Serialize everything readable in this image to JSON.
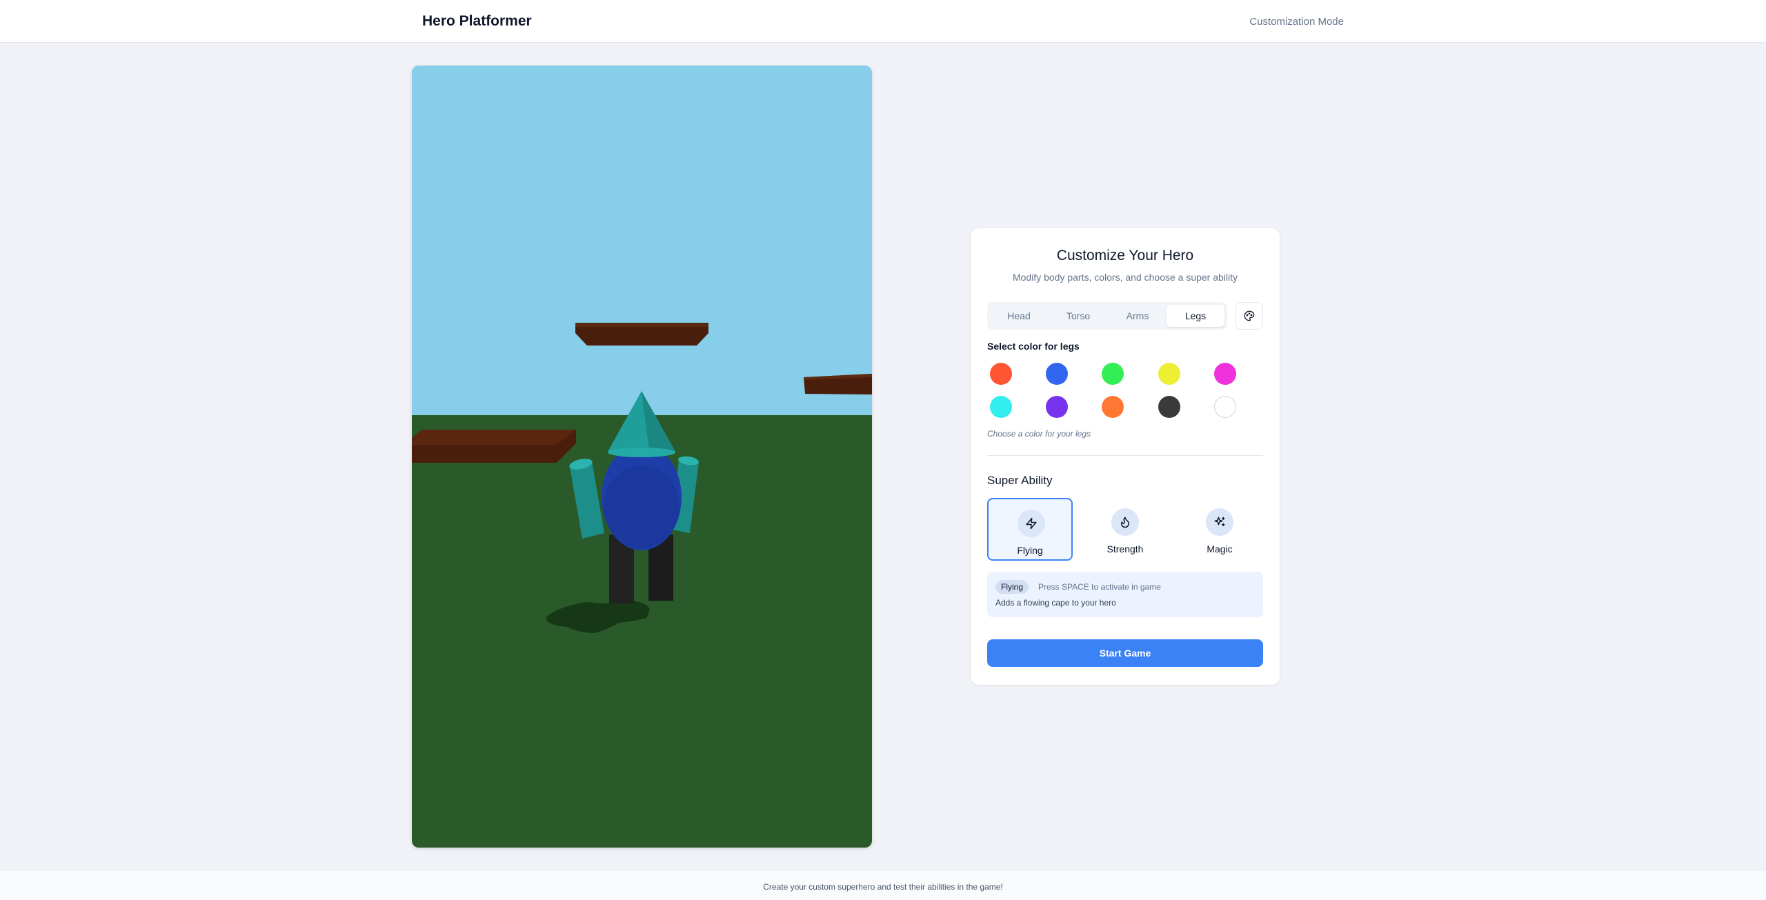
{
  "header": {
    "title": "Hero Platformer",
    "mode": "Customization Mode"
  },
  "scene": {
    "sky_color": "#87ceeb",
    "ground_color": "#2a5a2a",
    "platform_color": "#4a1e0c",
    "hero": {
      "head_color": "#1f9e9a",
      "torso_color": "#1d3ea8",
      "arms_color": "#1f9e9a",
      "legs_color": "#222222",
      "head_shape": "cone"
    }
  },
  "panel": {
    "title": "Customize Your Hero",
    "subtitle": "Modify body parts, colors, and choose a super ability",
    "tabs": [
      {
        "label": "Head",
        "active": false
      },
      {
        "label": "Torso",
        "active": false
      },
      {
        "label": "Arms",
        "active": false
      },
      {
        "label": "Legs",
        "active": true
      }
    ],
    "palette_icon": "palette-icon",
    "color_section_label": "Select color for legs",
    "colors": [
      "#ff5533",
      "#3366ee",
      "#33ee55",
      "#eeee33",
      "#ee33dd",
      "#33eeee",
      "#7733ee",
      "#ff7733",
      "#3a3a3a",
      "#ffffff"
    ],
    "color_hint": "Choose a color for your legs",
    "ability_title": "Super Ability",
    "abilities": [
      {
        "label": "Flying",
        "icon": "lightning-icon",
        "selected": true
      },
      {
        "label": "Strength",
        "icon": "flame-icon",
        "selected": false
      },
      {
        "label": "Magic",
        "icon": "sparkles-icon",
        "selected": false
      }
    ],
    "info": {
      "badge": "Flying",
      "hint": "Press SPACE to activate in game",
      "description": "Adds a flowing cape to your hero"
    },
    "start_label": "Start Game",
    "accent_color": "#3b82f6"
  },
  "footer": {
    "text": "Create your custom superhero and test their abilities in the game!"
  }
}
